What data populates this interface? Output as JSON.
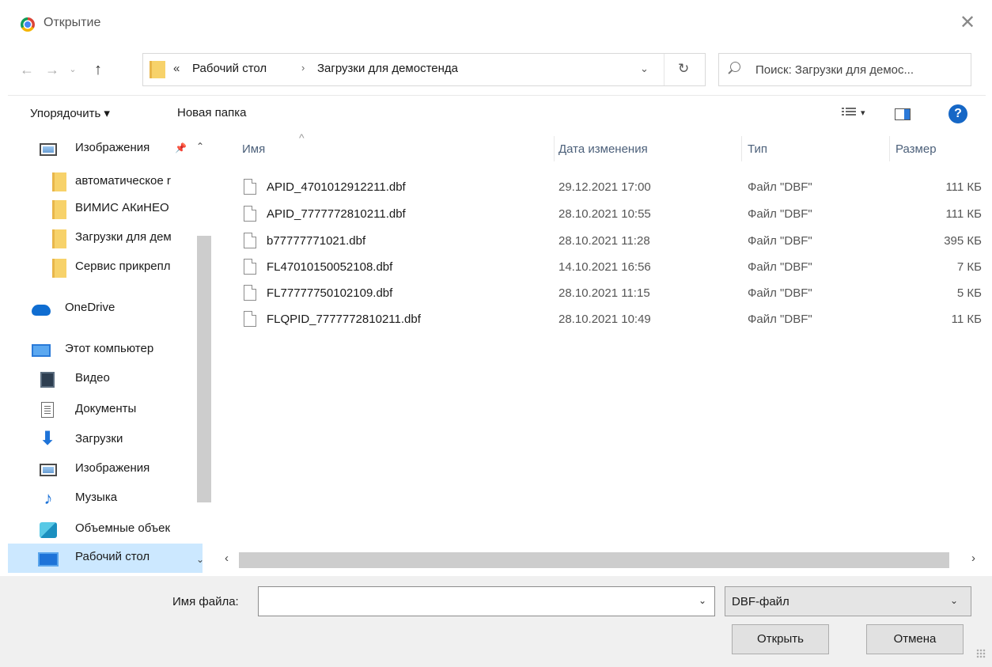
{
  "window": {
    "title": "Открытие"
  },
  "address": {
    "crumbs": [
      "Рабочий стол",
      "Загрузки для демостенда"
    ],
    "overflow": "«"
  },
  "search": {
    "placeholder": "Поиск: Загрузки для демос..."
  },
  "toolbar": {
    "organize": "Упорядочить ▾",
    "new_folder": "Новая папка"
  },
  "nav": {
    "items": [
      {
        "label": "Изображения",
        "icon": "images-icon",
        "pinned": true
      },
      {
        "label": "автоматическое r",
        "icon": "folder-icon"
      },
      {
        "label": "ВИМИС АКиНЕО",
        "icon": "folder-icon"
      },
      {
        "label": "Загрузки для дем",
        "icon": "folder-icon"
      },
      {
        "label": "Сервис прикрепл",
        "icon": "folder-icon"
      },
      {
        "label": "OneDrive",
        "icon": "cloud-icon"
      },
      {
        "label": "Этот компьютер",
        "icon": "computer-icon"
      },
      {
        "label": "Видео",
        "icon": "video-icon"
      },
      {
        "label": "Документы",
        "icon": "documents-icon"
      },
      {
        "label": "Загрузки",
        "icon": "downloads-icon"
      },
      {
        "label": "Изображения",
        "icon": "images-icon"
      },
      {
        "label": "Музыка",
        "icon": "music-icon"
      },
      {
        "label": "Объемные объек",
        "icon": "3d-objects-icon"
      },
      {
        "label": "Рабочий стол",
        "icon": "desktop-icon",
        "selected": true
      }
    ]
  },
  "columns": {
    "name": "Имя",
    "date": "Дата изменения",
    "type": "Тип",
    "size": "Размер"
  },
  "files": [
    {
      "name": "APID_4701012912211.dbf",
      "date": "29.12.2021 17:00",
      "type": "Файл \"DBF\"",
      "size": "111 КБ"
    },
    {
      "name": "APID_7777772810211.dbf",
      "date": "28.10.2021 10:55",
      "type": "Файл \"DBF\"",
      "size": "111 КБ"
    },
    {
      "name": "b77777771021.dbf",
      "date": "28.10.2021 11:28",
      "type": "Файл \"DBF\"",
      "size": "395 КБ"
    },
    {
      "name": "FL47010150052108.dbf",
      "date": "14.10.2021 16:56",
      "type": "Файл \"DBF\"",
      "size": "7 КБ"
    },
    {
      "name": "FL77777750102109.dbf",
      "date": "28.10.2021 11:15",
      "type": "Файл \"DBF\"",
      "size": "5 КБ"
    },
    {
      "name": "FLQPID_7777772810211.dbf",
      "date": "28.10.2021 10:49",
      "type": "Файл \"DBF\"",
      "size": "11 КБ"
    }
  ],
  "bottom": {
    "filename_label": "Имя файла:",
    "filename_value": "",
    "filter": "DBF-файл",
    "open_label": "Открыть",
    "cancel_label": "Отмена"
  },
  "colors": {
    "selected": "#cce8ff",
    "help": "#1667c6",
    "folder": "#f7d26a"
  }
}
